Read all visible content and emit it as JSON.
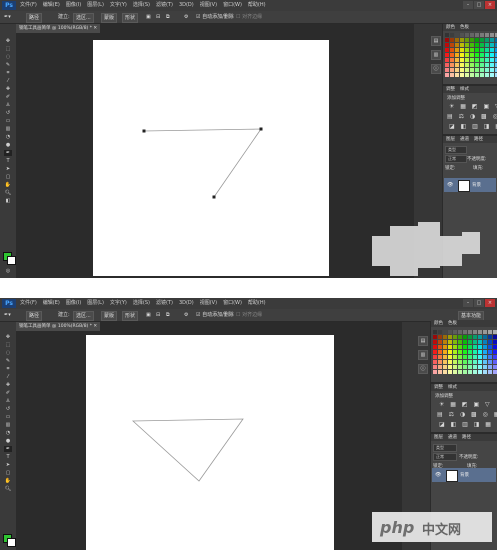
{
  "app": {
    "logo": "Ps",
    "menu": [
      "文件(F)",
      "编辑(E)",
      "图像(I)",
      "图层(L)",
      "文字(Y)",
      "选择(S)",
      "滤镜(T)",
      "3D(D)",
      "视图(V)",
      "窗口(W)",
      "帮助(H)"
    ],
    "window_controls": [
      "–",
      "□",
      "×"
    ],
    "workspace_label": "基本功能"
  },
  "options": {
    "mode": "路径",
    "make_label": "建立:",
    "selection_btn": "选区...",
    "mask_btn": "蒙版",
    "shape_btn": "形状",
    "auto_add_delete": "自动添加/删除",
    "align_edges": "对齐边缘"
  },
  "document": {
    "tab_title": "钢笔工具画简单 @ 100%(RGB/8) *"
  },
  "panels": {
    "color_tabs": [
      "颜色",
      "色板"
    ],
    "adjust_tabs": [
      "调整",
      "样式"
    ],
    "adjust_title": "添加调整",
    "adjust_rows": [
      "☀ ▦ ◩ ▣ ▽",
      "▤ ⚖ ◑ ▩ ◎ ▦",
      "◪ ◧ ▥ ◨ ▦"
    ],
    "layer_tabs": [
      "图层",
      "通道",
      "路径"
    ],
    "layer_kind": "类型",
    "blend_mode": "正常",
    "opacity_label": "不透明度:",
    "lock_label": "锁定:",
    "fill_label": "填充:",
    "layer_name": "背景",
    "eye_icon": "👁"
  },
  "watermark": {
    "text_php": "php",
    "text_cn": "中文网"
  },
  "colors": {
    "foreground": "#2fc431",
    "background": "#ffffff",
    "menubar": "#3b3b3b",
    "panel": "#454545",
    "workspace": "#2b2b2b"
  }
}
